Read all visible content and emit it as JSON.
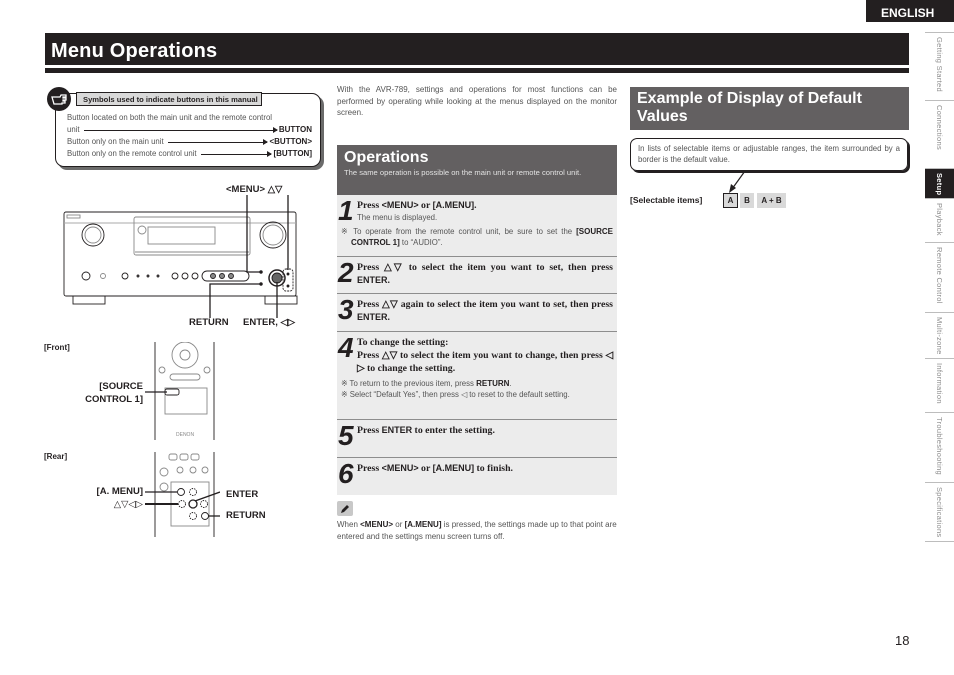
{
  "header": {
    "language": "ENGLISH",
    "title": "Menu Operations"
  },
  "side_nav": {
    "items": [
      {
        "label": "Getting Started",
        "active": false
      },
      {
        "label": "Connections",
        "active": false
      },
      {
        "label": "Setup",
        "active": true
      },
      {
        "label": "Playback",
        "active": false
      },
      {
        "label": "Remote Control",
        "active": false
      },
      {
        "label": "Multi-zone",
        "active": false
      },
      {
        "label": "Information",
        "active": false
      },
      {
        "label": "Troubleshooting",
        "active": false
      },
      {
        "label": "Specifications",
        "active": false
      }
    ]
  },
  "symbols_box": {
    "icon": "pointing-hand-icon",
    "heading": "Symbols used to indicate buttons in this manual",
    "rows": [
      {
        "text_line1": "Button located on both the main unit and the remote control",
        "text": "unit",
        "symbol": "BUTTON"
      },
      {
        "text": "Button only on the main unit",
        "symbol": "<BUTTON>"
      },
      {
        "text": "Button only on the remote control unit",
        "symbol": "[BUTTON]"
      }
    ]
  },
  "main_unit_diagram": {
    "labels": {
      "menu": "<MENU> △▽",
      "return": "RETURN",
      "enter": "ENTER, ◁▷"
    }
  },
  "remote_diagram": {
    "front_label": "[Front]",
    "rear_label": "[Rear]",
    "source_control_line1": "[SOURCE",
    "source_control_line2": "CONTROL 1]",
    "a_menu": "[A. MENU]",
    "arrows": "△▽◁▷",
    "enter": "ENTER",
    "return": "RETURN",
    "brand": "DENON"
  },
  "intro": "With the AVR-789, settings and operations for most functions can be performed by operating while looking at the menus displayed on the monitor screen.",
  "operations": {
    "title": "Operations",
    "subtitle": "The same operation is possible on the main unit or remote control unit.",
    "steps": [
      {
        "num": "1",
        "main_pre": "Press ",
        "main_k1": "<MENU>",
        "main_mid": " or ",
        "main_k2": "[A.MENU]",
        "main_post": ".",
        "sub": "The menu is displayed.",
        "note_pre": "※ To operate from the remote control unit, be sure to set the ",
        "note_key": "[SOURCE CONTROL 1]",
        "note_post": " to “AUDIO”."
      },
      {
        "num": "2",
        "main_pre": "Press △▽ to select the item you want to set, then press ",
        "main_k1": "ENTER",
        "main_post": "."
      },
      {
        "num": "3",
        "main_pre": "Press △▽ again to select the item you want to set, then press ",
        "main_k1": "ENTER",
        "main_post": "."
      },
      {
        "num": "4",
        "main_line1": "To change the setting:",
        "main_line2": "Press △▽ to select the item you want to change, then press ◁ ▷ to change the setting.",
        "note1_pre": "※ To return to the previous item, press ",
        "note1_key": "RETURN",
        "note1_post": ".",
        "note2": "※ Select “Default Yes”, then press ◁ to reset to the default setting."
      },
      {
        "num": "5",
        "main_pre": "Press ",
        "main_k1": "ENTER",
        "main_post": " to enter the setting."
      },
      {
        "num": "6",
        "main_pre": "Press ",
        "main_k1": "<MENU>",
        "main_mid": " or ",
        "main_k2": "[A.MENU]",
        "main_post": " to finish."
      }
    ]
  },
  "note": {
    "icon": "pencil-icon",
    "pre": "When ",
    "k1": "<MENU>",
    "mid": " or ",
    "k2": "[A.MENU]",
    "post": " is pressed, the settings made up to that point are entered and the settings menu screen turns off."
  },
  "example": {
    "title": "Example of Display of Default Values",
    "callout": "In lists of selectable items or adjustable ranges, the item surrounded by a border is the default value.",
    "selectable_label": "[Selectable items]",
    "items": [
      {
        "label": "A",
        "default": true
      },
      {
        "label": "B",
        "default": false
      },
      {
        "label": "A + B",
        "default": false
      }
    ]
  },
  "page_number": "18"
}
